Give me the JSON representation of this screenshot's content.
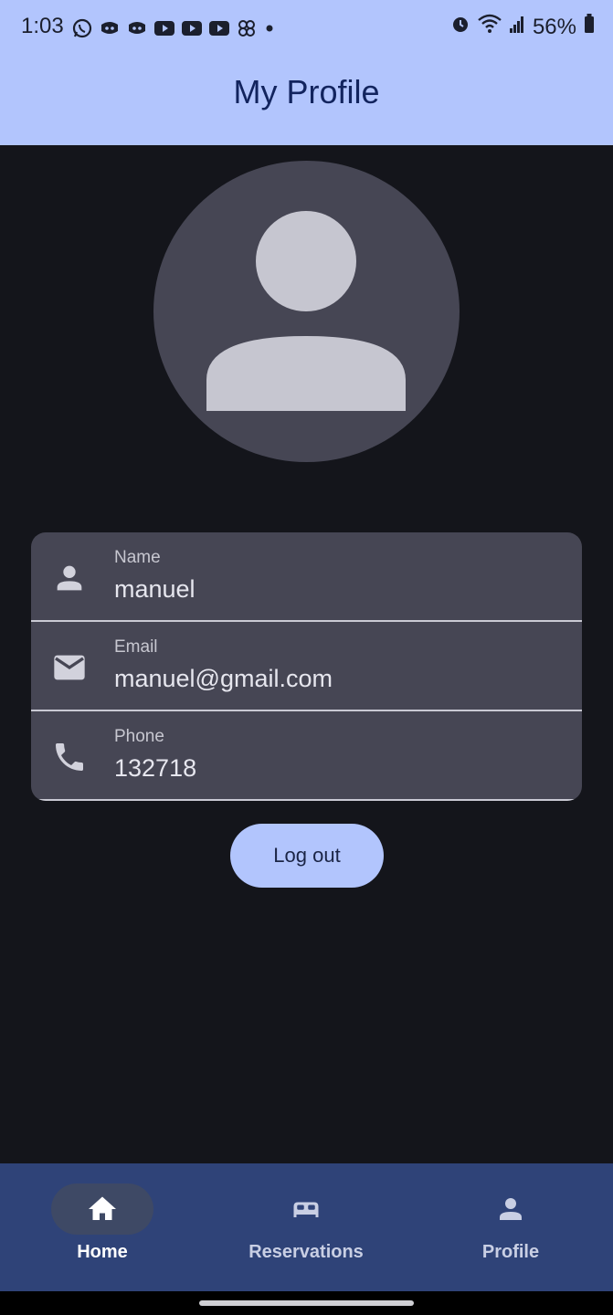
{
  "status_bar": {
    "time": "1:03",
    "battery": "56%",
    "notification_icons": [
      "whatsapp-icon",
      "discord-icon",
      "discord-icon",
      "youtube-icon",
      "youtube-icon",
      "youtube-icon",
      "pinwheel-icon",
      "dot-icon"
    ],
    "system_icons": [
      "alarm-icon",
      "wifi-icon",
      "signal-icon",
      "battery-icon"
    ]
  },
  "app_bar": {
    "title": "My Profile"
  },
  "avatar": {
    "icon": "person-avatar-icon"
  },
  "profile": {
    "fields": [
      {
        "label": "Name",
        "value": "manuel",
        "icon": "person-icon"
      },
      {
        "label": "Email",
        "value": "manuel@gmail.com",
        "icon": "mail-icon"
      },
      {
        "label": "Phone",
        "value": "132718",
        "icon": "phone-icon"
      }
    ]
  },
  "actions": {
    "logout_label": "Log out"
  },
  "bottom_nav": {
    "items": [
      {
        "label": "Home",
        "icon": "home-icon",
        "active": true
      },
      {
        "label": "Reservations",
        "icon": "bed-icon",
        "active": false
      },
      {
        "label": "Profile",
        "icon": "person-icon",
        "active": false
      }
    ]
  },
  "colors": {
    "background": "#14151b",
    "app_bar": "#b2c5fd",
    "title_text": "#12245e",
    "card": "#464654",
    "bottom_nav": "#2f4378",
    "accent_button": "#b2c5fd"
  }
}
